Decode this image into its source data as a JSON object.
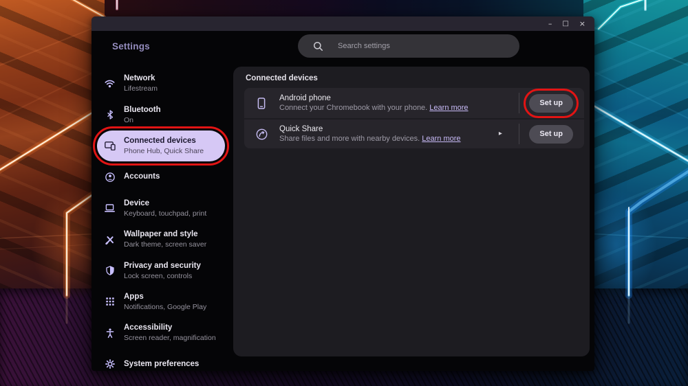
{
  "window": {
    "app_title": "Settings",
    "controls": {
      "minimize": "–",
      "maximize": "□",
      "close": "×"
    }
  },
  "search": {
    "placeholder": "Search settings"
  },
  "sidebar": {
    "items": [
      {
        "label": "Network",
        "sublabel": "Lifestream",
        "icon": "wifi-icon"
      },
      {
        "label": "Bluetooth",
        "sublabel": "On",
        "icon": "bluetooth-icon"
      },
      {
        "label": "Connected devices",
        "sublabel": "Phone Hub, Quick Share",
        "icon": "connected-devices-icon",
        "selected": true
      },
      {
        "label": "Accounts",
        "sublabel": "",
        "icon": "account-circle-icon"
      },
      {
        "label": "Device",
        "sublabel": "Keyboard, touchpad, print",
        "icon": "laptop-icon"
      },
      {
        "label": "Wallpaper and style",
        "sublabel": "Dark theme, screen saver",
        "icon": "brush-icon"
      },
      {
        "label": "Privacy and security",
        "sublabel": "Lock screen, controls",
        "icon": "shield-icon"
      },
      {
        "label": "Apps",
        "sublabel": "Notifications, Google Play",
        "icon": "apps-grid-icon"
      },
      {
        "label": "Accessibility",
        "sublabel": "Screen reader, magnification",
        "icon": "accessibility-icon"
      },
      {
        "label": "System preferences",
        "sublabel": "",
        "icon": "gear-icon"
      }
    ]
  },
  "content": {
    "section_title": "Connected devices",
    "rows": [
      {
        "title": "Android phone",
        "description": "Connect your Chromebook with your phone.",
        "link_label": "Learn more",
        "button_label": "Set up",
        "icon": "smartphone-icon",
        "annotated": true
      },
      {
        "title": "Quick Share",
        "description": "Share files and more with nearby devices.",
        "link_label": "Learn more",
        "button_label": "Set up",
        "icon": "quick-share-icon",
        "has_chevron": true
      }
    ]
  },
  "icons": {
    "chevron_right": "▸"
  },
  "colors": {
    "annotation_red": "#e21414",
    "accent_purple": "#c8bfff",
    "selected_item_bg": "#d6c8f5",
    "panel_bg": "#1d1c21",
    "card_bg": "#27252b"
  }
}
